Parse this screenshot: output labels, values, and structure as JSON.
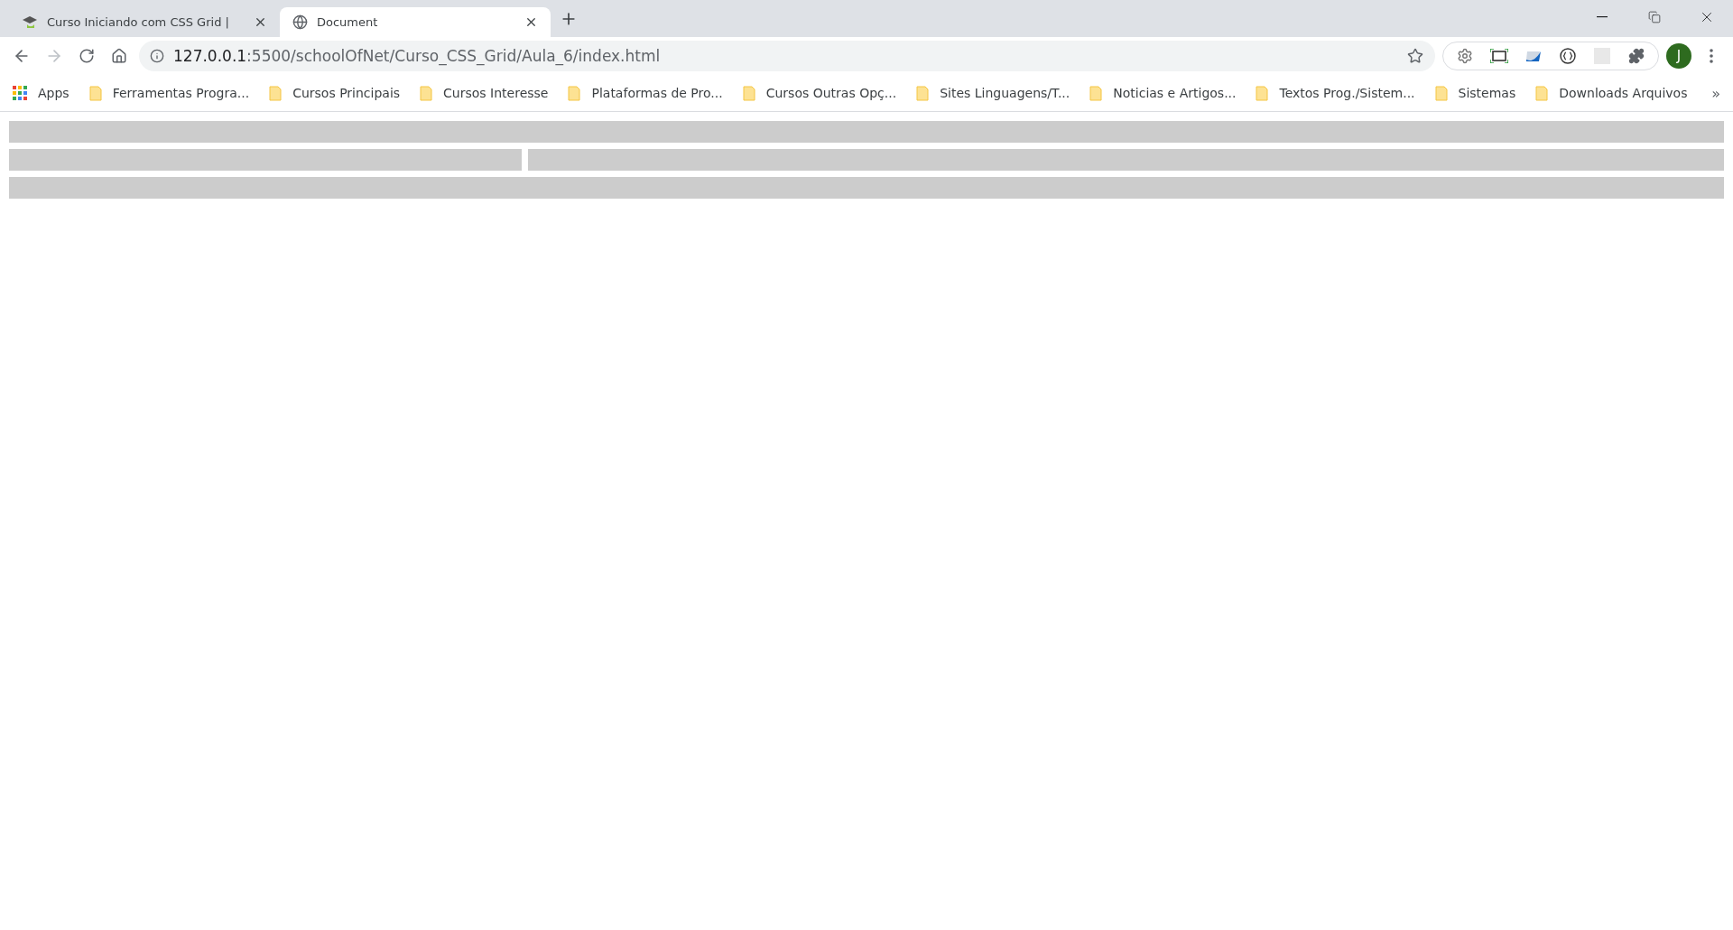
{
  "tabs": [
    {
      "title": "Curso Iniciando com CSS Grid |",
      "kind": "site",
      "selected": false
    },
    {
      "title": "Document",
      "kind": "globe",
      "selected": true
    }
  ],
  "address_bar": {
    "host": "127.0.0.1",
    "path": ":5500/schoolOfNet/Curso_CSS_Grid/Aula_6/index.html"
  },
  "profile": {
    "initial": "J"
  },
  "bookmarks": [
    {
      "label": "Apps",
      "kind": "apps"
    },
    {
      "label": "Ferramentas Progra...",
      "kind": "folder"
    },
    {
      "label": "Cursos Principais",
      "kind": "folder"
    },
    {
      "label": "Cursos Interesse",
      "kind": "folder"
    },
    {
      "label": "Plataformas de Pro...",
      "kind": "folder"
    },
    {
      "label": "Cursos Outras Opç...",
      "kind": "folder"
    },
    {
      "label": "Sites Linguagens/T...",
      "kind": "folder"
    },
    {
      "label": "Noticias e Artigos...",
      "kind": "folder"
    },
    {
      "label": "Textos Prog./Sistem...",
      "kind": "folder"
    },
    {
      "label": "Sistemas",
      "kind": "folder"
    },
    {
      "label": "Downloads Arquivos",
      "kind": "folder"
    }
  ],
  "bookmarks_overflow": "»"
}
